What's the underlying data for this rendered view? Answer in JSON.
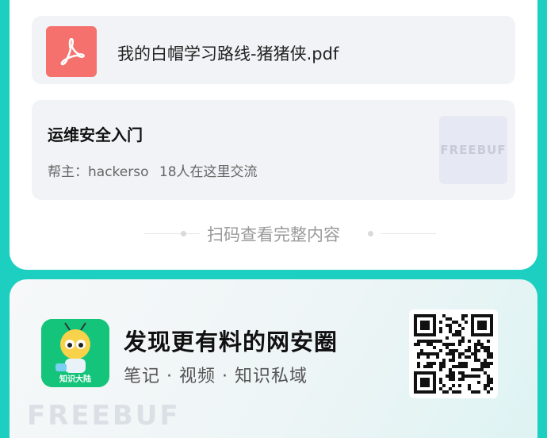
{
  "file": {
    "name": "我的白帽学习路线-猪猪侠.pdf",
    "icon": "pdf-icon"
  },
  "group": {
    "title": "运维安全入门",
    "owner": "帮主：hackerso",
    "members": "18人在这里交流",
    "logo_text": "FREEBUF"
  },
  "scan_more": "扫码查看完整内容",
  "promo": {
    "app_icon_label": "知识大陆",
    "headline": "发现更有料的网安圈",
    "subline": "笔记 · 视频 · 知识私域"
  },
  "watermark": "FREEBUF",
  "colors": {
    "background": "#1ccfc0",
    "pdf": "#f4716e",
    "app": "#14c47a"
  }
}
